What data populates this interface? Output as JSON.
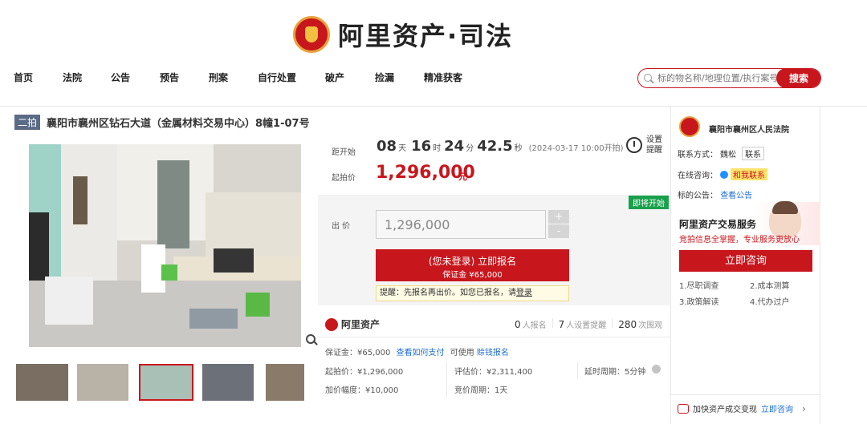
{
  "header": {
    "logo_text": "阿里资产·司法"
  },
  "nav": {
    "items": [
      "首页",
      "法院",
      "公告",
      "预告",
      "刑案",
      "自行处置",
      "破产",
      "捡漏",
      "精准获客"
    ]
  },
  "search": {
    "placeholder": "标的物名称/地理位置/执行案号",
    "button": "搜索"
  },
  "item": {
    "round": "二拍",
    "title": "襄阳市襄州区钻石大道（金属材料交易中心）8幢1-07号",
    "countdown": {
      "label": "距开始",
      "days": "08",
      "d_unit": "天",
      "hours": "16",
      "h_unit": "时",
      "minutes": "24",
      "m_unit": "分",
      "seconds": "42.5",
      "s_unit": "秒",
      "start_note": "(2024-03-17 10:00开拍)"
    },
    "reminder": {
      "line1": "设置",
      "line2": "提醒"
    },
    "start_price": {
      "label": "起拍价",
      "value": "1,296,000",
      "unit": "元"
    },
    "tag_soon": "即将开始",
    "bid": {
      "label": "出 价",
      "value": "1,296,000",
      "plus": "+",
      "minus": "-"
    },
    "signup": {
      "line1": "(您未登录) 立即报名",
      "line2": "保证金 ¥65,000"
    },
    "tip": {
      "text": "提醒：先报名再出价。如您已报名，请",
      "link": "登录"
    },
    "stats_brand": "阿里资产",
    "stats": {
      "signups": "0",
      "signups_label": "人报名",
      "reminders": "7",
      "reminders_label": "人设置提醒",
      "views": "280",
      "views_label": "次围观"
    },
    "details": {
      "deposit": "保证金：¥65,000",
      "how_pay": "查看如何支付",
      "can_use": "可使用",
      "loan_signup": "赊钱报名",
      "start_price": "起拍价：¥1,296,000",
      "appraisal": "评估价：¥2,311,400",
      "delay": "延时周期：5分钟",
      "increment": "加价幅度：¥10,000",
      "period": "竞价周期：1天"
    }
  },
  "sidebar": {
    "court": "襄阳市襄州区人民法院",
    "contact_label": "联系方式：",
    "contact_name": "魏松",
    "contact_btn": "联系",
    "online_label": "在线咨询：",
    "online_btn": "和我联系",
    "notice_label": "标的公告：",
    "notice_link": "查看公告",
    "service_title": "阿里资产交易服务",
    "service_sub": "竞拍信息全掌握，专业服务更放心",
    "consult_btn": "立即咨询",
    "services": [
      "1.尽职调查",
      "2.成本测算",
      "3.政策解读",
      "4.代办过户"
    ],
    "speed_text": "加快资产成交变现",
    "speed_link": "立即咨询"
  }
}
